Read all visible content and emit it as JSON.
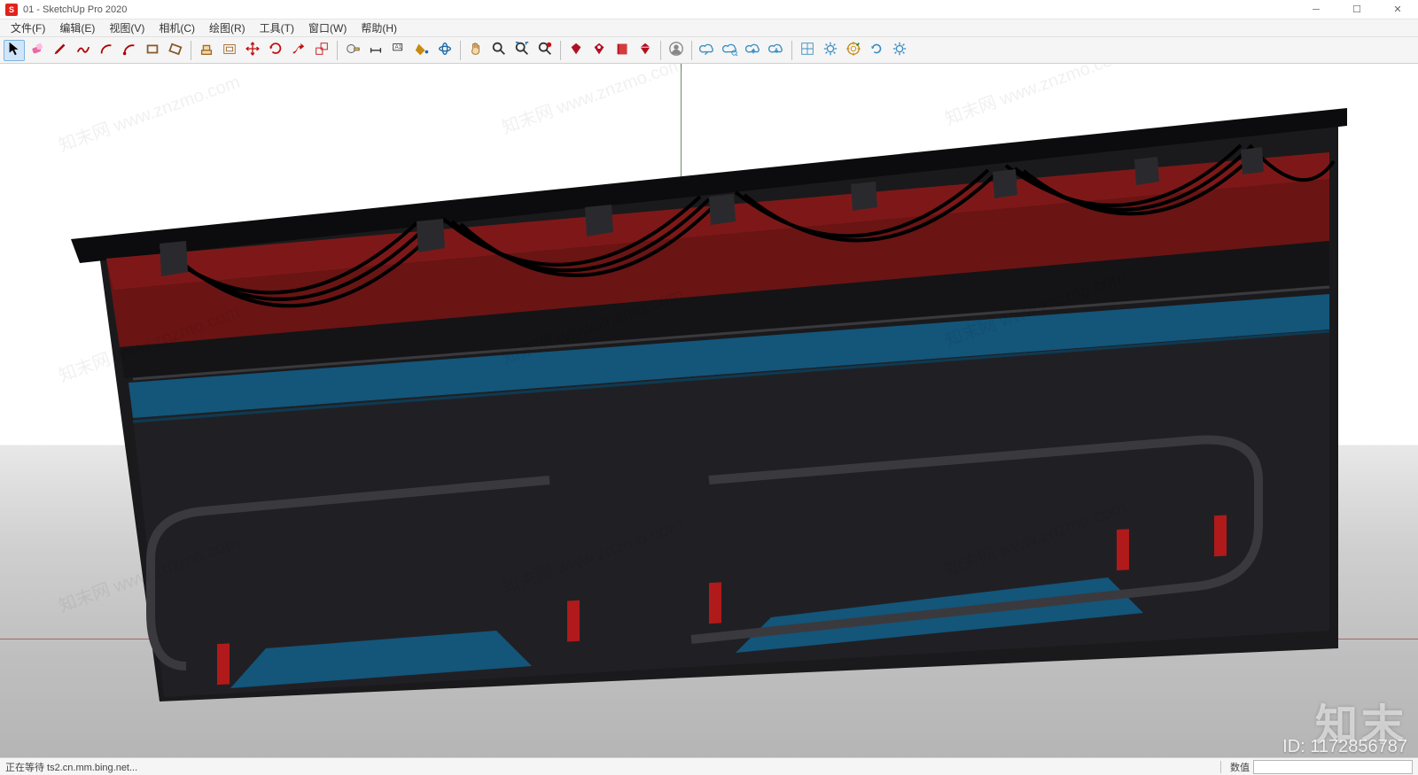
{
  "window": {
    "title": "01 - SketchUp Pro 2020",
    "app_glyph": "S"
  },
  "menubar": [
    {
      "id": "file",
      "label": "文件(F)"
    },
    {
      "id": "edit",
      "label": "编辑(E)"
    },
    {
      "id": "view",
      "label": "视图(V)"
    },
    {
      "id": "camera",
      "label": "相机(C)"
    },
    {
      "id": "draw",
      "label": "绘图(R)"
    },
    {
      "id": "tools",
      "label": "工具(T)"
    },
    {
      "id": "window",
      "label": "窗口(W)"
    },
    {
      "id": "help",
      "label": "帮助(H)"
    }
  ],
  "toolbar_groups": [
    [
      {
        "id": "select",
        "name": "select-tool",
        "color": "#000",
        "glyph": "arrow",
        "selected": true
      },
      {
        "id": "eraser",
        "name": "eraser-tool",
        "color": "#e86aa6",
        "glyph": "eraser"
      },
      {
        "id": "line",
        "name": "line-tool",
        "color": "#b00000",
        "glyph": "pencil"
      },
      {
        "id": "freehand",
        "name": "freehand-tool",
        "color": "#b00000",
        "glyph": "squiggle"
      },
      {
        "id": "arc",
        "name": "arc-tool",
        "color": "#b00000",
        "glyph": "arc"
      },
      {
        "id": "arc2",
        "name": "arc2-tool",
        "color": "#b00000",
        "glyph": "arc2"
      },
      {
        "id": "rect",
        "name": "rectangle-tool",
        "color": "#8a5a2a",
        "glyph": "rect"
      },
      {
        "id": "rotrect",
        "name": "rotated-rectangle-tool",
        "color": "#8a5a2a",
        "glyph": "rotrect"
      }
    ],
    [
      {
        "id": "pushpull",
        "name": "pushpull-tool",
        "color": "#a06a2a",
        "glyph": "pushpull"
      },
      {
        "id": "offset",
        "name": "offset-tool",
        "color": "#a06a2a",
        "glyph": "offset"
      },
      {
        "id": "move",
        "name": "move-tool",
        "color": "#c21010",
        "glyph": "move"
      },
      {
        "id": "rotate",
        "name": "rotate-tool",
        "color": "#c21010",
        "glyph": "rotate"
      },
      {
        "id": "followme",
        "name": "followme-tool",
        "color": "#c21010",
        "glyph": "follow"
      },
      {
        "id": "scale",
        "name": "scale-tool",
        "color": "#c21010",
        "glyph": "scale"
      }
    ],
    [
      {
        "id": "tape",
        "name": "tape-measure-tool",
        "color": "#444",
        "glyph": "tape"
      },
      {
        "id": "dim",
        "name": "dimension-tool",
        "color": "#444",
        "glyph": "dim"
      },
      {
        "id": "text",
        "name": "text-tool",
        "color": "#444",
        "glyph": "text"
      },
      {
        "id": "paint",
        "name": "paint-bucket-tool",
        "color": "#c78a10",
        "glyph": "bucket"
      },
      {
        "id": "orbit",
        "name": "orbit-tool",
        "color": "#1a6aa8",
        "glyph": "orbit"
      }
    ],
    [
      {
        "id": "pan",
        "name": "pan-tool",
        "color": "#1a6aa8",
        "glyph": "hand"
      },
      {
        "id": "zoom",
        "name": "zoom-tool",
        "color": "#c78a10",
        "glyph": "zoom"
      },
      {
        "id": "zoomext",
        "name": "zoom-extents-tool",
        "color": "#1a6aa8",
        "glyph": "zoomext"
      },
      {
        "id": "zoomwin",
        "name": "zoom-window-tool",
        "color": "#c21010",
        "glyph": "zoomwin"
      }
    ],
    [
      {
        "id": "ext1",
        "name": "extension-1",
        "color": "#b01020",
        "glyph": "diamond"
      },
      {
        "id": "ext2",
        "name": "extension-2",
        "color": "#b01020",
        "glyph": "diamond2"
      },
      {
        "id": "ext3",
        "name": "extension-3",
        "color": "#b01020",
        "glyph": "book"
      },
      {
        "id": "ext4",
        "name": "extension-4",
        "color": "#b01020",
        "glyph": "ruby"
      }
    ],
    [
      {
        "id": "user",
        "name": "user-account",
        "color": "#777",
        "glyph": "user"
      }
    ],
    [
      {
        "id": "cloud1",
        "name": "cloud-sync-1",
        "color": "#3a8ec2",
        "glyph": "cloudlink"
      },
      {
        "id": "cloud2",
        "name": "cloud-sync-2",
        "color": "#3a8ec2",
        "glyph": "cloudq"
      },
      {
        "id": "cloud3",
        "name": "cloud-upload",
        "color": "#3a8ec2",
        "glyph": "cloudup"
      },
      {
        "id": "cloud4",
        "name": "cloud-download",
        "color": "#3a8ec2",
        "glyph": "clouddn"
      }
    ],
    [
      {
        "id": "grid",
        "name": "grid-tool",
        "color": "#3a8ec2",
        "glyph": "grid"
      },
      {
        "id": "gear1",
        "name": "settings-1",
        "color": "#3a8ec2",
        "glyph": "gear"
      },
      {
        "id": "target",
        "name": "target-tool",
        "color": "#c78a10",
        "glyph": "target"
      },
      {
        "id": "refresh",
        "name": "refresh-tool",
        "color": "#3a8ec2",
        "glyph": "refresh"
      },
      {
        "id": "gear2",
        "name": "settings-2",
        "color": "#3a8ec2",
        "glyph": "gear"
      }
    ]
  ],
  "statusbar": {
    "left": "正在等待 ts2.cn.mm.bing.net...",
    "measure_label": "数值"
  },
  "overlay": {
    "watermark_text": "知末网 www.znzmo.com",
    "brand_text": "知末",
    "id_text": "ID: 1172856787"
  }
}
